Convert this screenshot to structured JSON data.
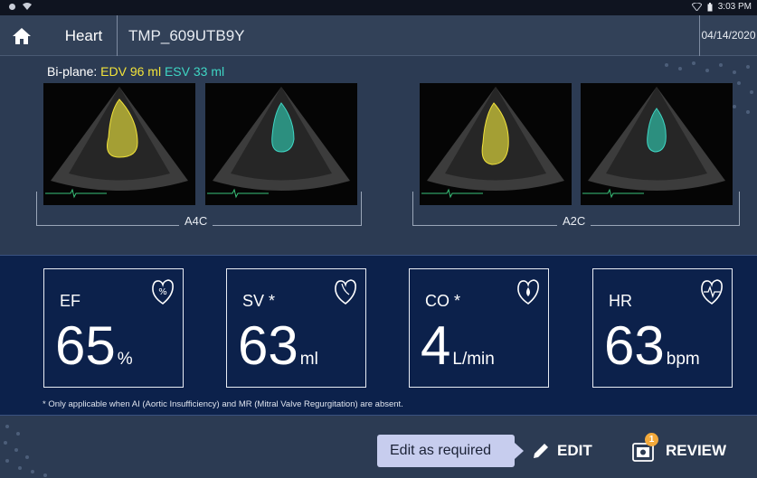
{
  "status_bar": {
    "time": "3:03 PM"
  },
  "header": {
    "organ": "Heart",
    "patient_id": "TMP_609UTB9Y",
    "date": "04/14/2020"
  },
  "biplane": {
    "label": "Bi-plane:",
    "edv": "EDV 96 ml",
    "esv": "ESV 33 ml"
  },
  "views": [
    {
      "label": "A4C"
    },
    {
      "label": "A2C"
    }
  ],
  "metrics": [
    {
      "label": "EF",
      "value": "65",
      "unit": "%",
      "icon": "heart-percent-icon"
    },
    {
      "label": "SV *",
      "value": "63",
      "unit": "ml",
      "icon": "heart-icon"
    },
    {
      "label": "CO *",
      "value": "4",
      "unit": "L/min",
      "icon": "heart-drop-icon"
    },
    {
      "label": "HR",
      "value": "63",
      "unit": "bpm",
      "icon": "heart-rate-icon"
    }
  ],
  "footnote": "* Only applicable when AI (Aortic Insufficiency) and MR (Mitral Valve Regurgitation) are absent.",
  "actions": {
    "tooltip": "Edit as required",
    "edit_label": "EDIT",
    "review_label": "REVIEW",
    "review_badge": "1"
  },
  "colors": {
    "edv": "#f2e33a",
    "esv": "#3fd6c4",
    "metrics_bg": "#0c214b",
    "header_bg": "#324158"
  }
}
